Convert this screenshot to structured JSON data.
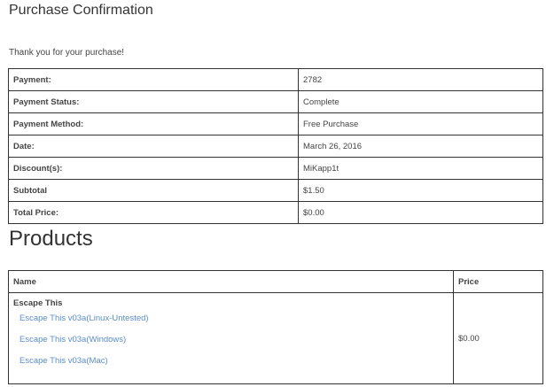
{
  "page": {
    "title": "Purchase Confirmation",
    "thanks": "Thank you for your purchase!"
  },
  "receipt": {
    "rows": [
      {
        "label": "Payment:",
        "value": "2782"
      },
      {
        "label": "Payment Status:",
        "value": "Complete"
      },
      {
        "label": "Payment Method:",
        "value": "Free Purchase"
      },
      {
        "label": "Date:",
        "value": "March 26, 2016"
      },
      {
        "label": "Discount(s):",
        "value": "MiKapp1t"
      },
      {
        "label": "Subtotal",
        "value": "$1.50"
      },
      {
        "label": "Total Price:",
        "value": "$0.00"
      }
    ]
  },
  "products": {
    "heading": "Products",
    "columns": {
      "name": "Name",
      "price": "Price"
    },
    "items": [
      {
        "name": "Escape This",
        "files": [
          "Escape This v03a(Linux-Untested)",
          "Escape This v03a(Windows)",
          "Escape This v03a(Mac)"
        ],
        "price": "$0.00"
      }
    ]
  },
  "colors": {
    "link": "#5b8ec7",
    "text": "#444444",
    "border": "#333333"
  }
}
